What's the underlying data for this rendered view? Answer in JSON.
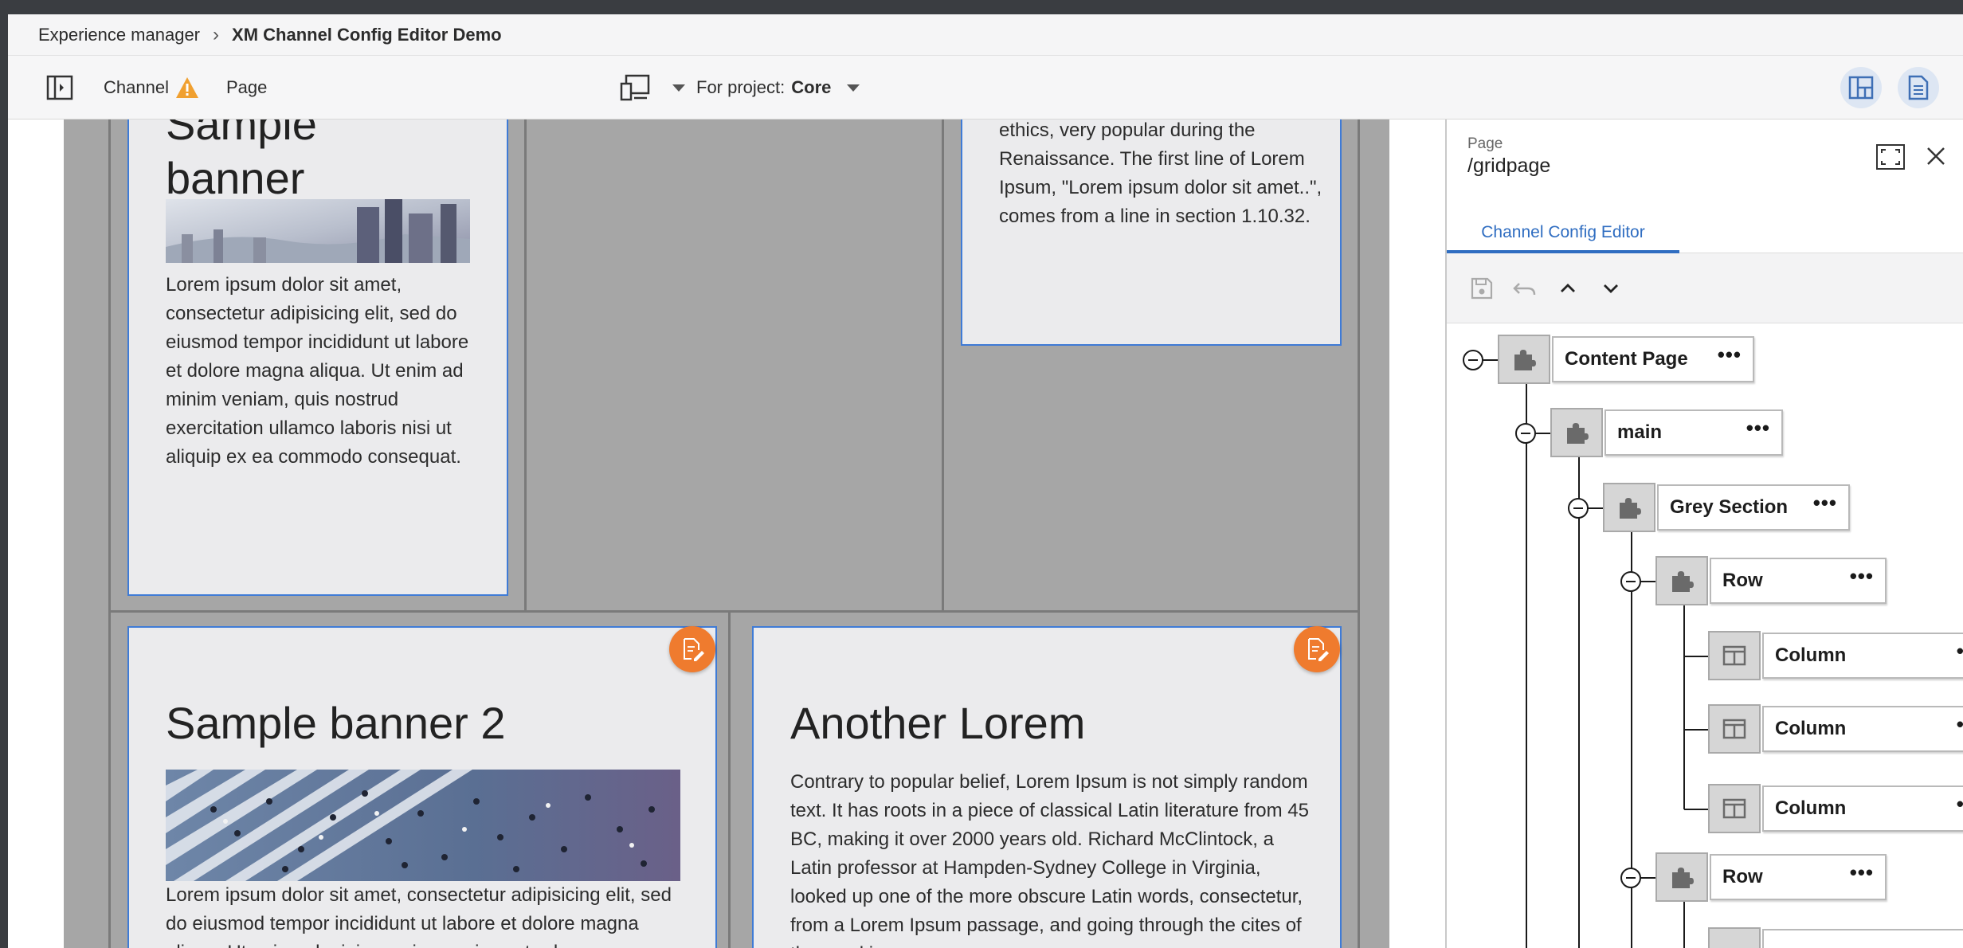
{
  "breadcrumb": {
    "root": "Experience manager",
    "current": "XM Channel Config Editor Demo"
  },
  "toolbar": {
    "channel_label": "Channel",
    "page_label": "Page",
    "project_prefix": "For project:",
    "project_value": "Core"
  },
  "canvas": {
    "banner1": {
      "title_line1": "Sample",
      "title_line2": "banner",
      "text": "Lorem ipsum dolor sit amet, consectetur adipisicing elit, sed do eiusmod tempor incididunt ut labore et dolore magna aliqua. Ut enim ad minim veniam, quis nostrud exercitation ullamco laboris nisi ut aliquip ex ea commodo consequat."
    },
    "lorem_card": {
      "text": "ethics, very popular during the Renaissance. The first line of Lorem Ipsum, \"Lorem ipsum dolor sit amet..\", comes from a line in section 1.10.32."
    },
    "banner2": {
      "title": "Sample banner 2",
      "text": "Lorem ipsum dolor sit amet, consectetur adipisicing elit, sed do eiusmod tempor incididunt ut labore et dolore magna aliqua. Ut enim ad minim veniam, quis nostrud"
    },
    "another": {
      "title": "Another Lorem",
      "text": "Contrary to popular belief, Lorem Ipsum is not simply random text. It has roots in a piece of classical Latin literature from 45 BC, making it over 2000 years old. Richard McClintock, a Latin professor at Hampden-Sydney College in Virginia, looked up one of the more obscure Latin words, consectetur, from a Lorem Ipsum passage, and going through the cites of the word in"
    }
  },
  "panel": {
    "type_label": "Page",
    "path": "/gridpage",
    "tab": "Channel Config Editor",
    "tree": [
      {
        "label": "Content Page",
        "icon": "puzzle-icon"
      },
      {
        "label": "main",
        "icon": "puzzle-icon"
      },
      {
        "label": "Grey Section",
        "icon": "puzzle-icon"
      },
      {
        "label": "Row",
        "icon": "puzzle-icon"
      },
      {
        "label": "Column",
        "icon": "column-layout-icon"
      },
      {
        "label": "Column",
        "icon": "column-layout-icon"
      },
      {
        "label": "Column",
        "icon": "column-layout-icon"
      },
      {
        "label": "Row",
        "icon": "puzzle-icon"
      }
    ],
    "more_label": "•••"
  },
  "colors": {
    "accent": "#2f6dc1",
    "edit_button": "#ef7b2e",
    "warning": "#f0a030",
    "selection_border": "#3f7bd6"
  }
}
